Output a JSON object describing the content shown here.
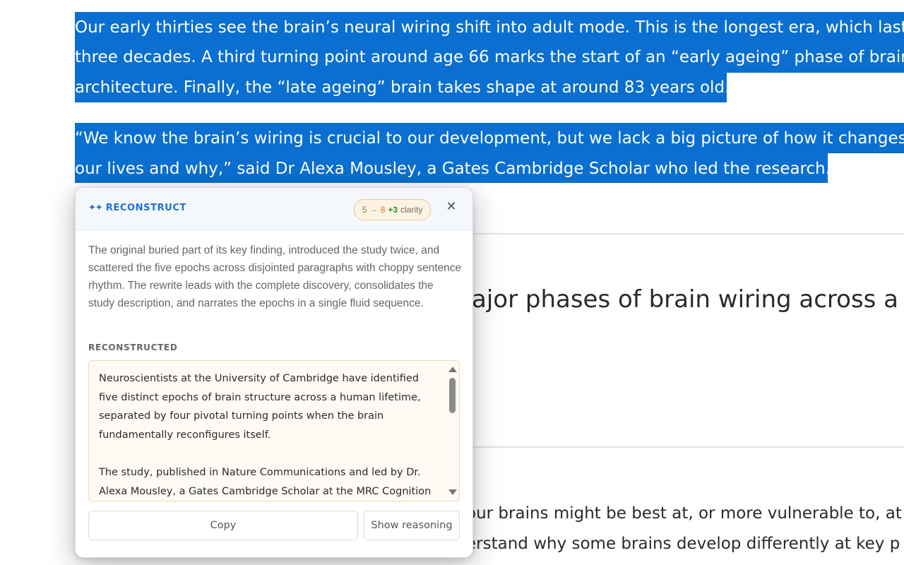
{
  "article": {
    "selected_lines": [
      "Our early thirties see the brain’s neural wiring shift into adult mode. This is the longest era, which last",
      "three decades. A third turning point around age 66 marks the start of an “early ageing” phase of brain",
      "architecture. Finally, the “late ageing” brain takes shape at around 83 years old.",
      "“We know the brain’s wiring is crucial to our development, but we lack a big picture of how it changes",
      "our lives and why,” said Dr Alexa Mousley, a Gates Cambridge Scholar who led the research."
    ],
    "heading_fragment": "ajor phases of brain wiring across a hu",
    "body_fragments": [
      "our brains might be best at, or more vulnerable to, at",
      "erstand why some brains develop differently at key p"
    ]
  },
  "popup": {
    "brand_label": "RECONSTRUCT",
    "brand_icon": "sparkles-icon",
    "score": {
      "old": "5",
      "arrow": "→",
      "new": "8",
      "delta": "+3",
      "word": "clarity"
    },
    "close_glyph": "✕",
    "summary": "The original buried part of its key finding, introduced the study twice, and scattered the five epochs across disjointed paragraphs with choppy sentence rhythm. The rewrite leads with the complete discovery, consolidates the study description, and narrates the epochs in a single fluid sequence.",
    "section_label": "RECONSTRUCTED",
    "reconstructed_paragraphs": [
      "Neuroscientists at the University of Cambridge have identified five distinct epochs of brain structure across a human lifetime, separated by four pivotal turning points when the brain fundamentally reconfigures itself.",
      "The study, published in Nature Communications and led by Dr. Alexa Mousley, a Gates Cambridge Scholar at the MRC Cognition and Brain"
    ],
    "copy_label": "Copy",
    "reasoning_label": "Show reasoning"
  }
}
